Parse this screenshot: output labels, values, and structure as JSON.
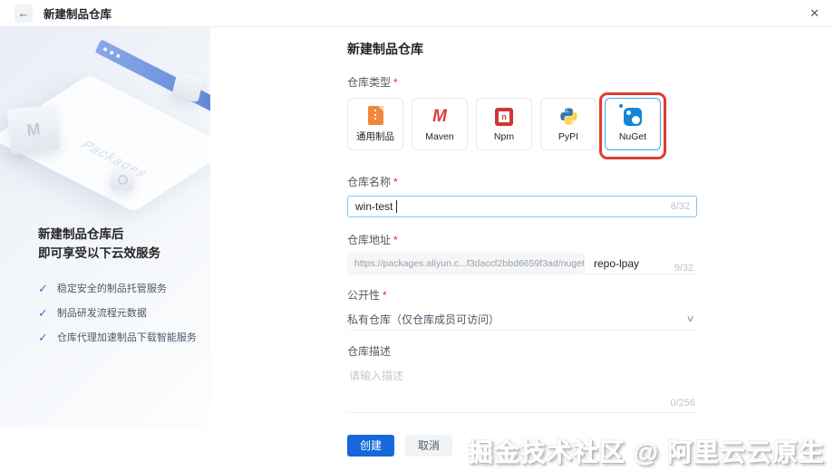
{
  "icons": {
    "back": "←",
    "close": "✕",
    "check": "✓",
    "chevron_down": "∨"
  },
  "header": {
    "title": "新建制品仓库"
  },
  "sidebar": {
    "illustration": {
      "card_text": "Packages",
      "box_letter": "M"
    },
    "heading_line1": "新建制品仓库后",
    "heading_line2": "即可享受以下云效服务",
    "benefits": [
      "稳定安全的制品托管服务",
      "制品研发流程元数据",
      "仓库代理加速制品下载智能服务"
    ]
  },
  "form": {
    "title": "新建制品仓库",
    "required_mark": "*",
    "type_label": "仓库类型",
    "types": [
      {
        "label": "通用制品"
      },
      {
        "label": "Maven",
        "icon_text": "M"
      },
      {
        "label": "Npm",
        "icon_text": "n"
      },
      {
        "label": "PyPI"
      },
      {
        "label": "NuGet",
        "selected": true
      }
    ],
    "name": {
      "label": "仓库名称",
      "value": "win-test",
      "counter": "8/32"
    },
    "address": {
      "label": "仓库地址",
      "prefix": "https://packages.aliyun.c...f3daccf2bbd6659f3ad/nuget/",
      "value": "repo-lpay",
      "counter": "9/32"
    },
    "visibility": {
      "label": "公开性",
      "value": "私有仓库（仅仓库成员可访问）"
    },
    "description": {
      "label": "仓库描述",
      "placeholder": "请输入描述",
      "counter": "0/256"
    },
    "actions": {
      "create": "创建",
      "cancel": "取消"
    }
  },
  "watermark": "掘金技术社区 @ 阿里云云原生",
  "colors": {
    "accent": "#1668dc",
    "selected_border": "#4aa3e8",
    "annotation_red": "#e23c30",
    "generic_orange": "#f0883a",
    "maven_red": "#e13b3f",
    "npm_red": "#cb3837",
    "pypi_blue": "#3776ab",
    "pypi_yellow": "#ffd343",
    "nuget_blue": "#1585d8",
    "check_blue": "#3573d9"
  }
}
